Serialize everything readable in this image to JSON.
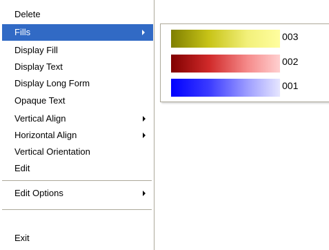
{
  "menu": {
    "items": [
      {
        "label": "Delete"
      },
      {
        "label": "Fills"
      },
      {
        "label": "Display Fill"
      },
      {
        "label": "Display Text"
      },
      {
        "label": "Display Long Form"
      },
      {
        "label": "Opaque Text"
      },
      {
        "label": "Vertical Align"
      },
      {
        "label": "Horizontal Align"
      },
      {
        "label": "Vertical Orientation"
      },
      {
        "label": "Edit"
      },
      {
        "label": "Edit Options"
      },
      {
        "label": "Exit"
      }
    ],
    "active_item": "Fills"
  },
  "submenu": {
    "fills": [
      {
        "label": "003",
        "color": "#c8c418"
      },
      {
        "label": "002",
        "color": "#d02a2a"
      },
      {
        "label": "001",
        "color": "#3b3bff"
      }
    ]
  }
}
